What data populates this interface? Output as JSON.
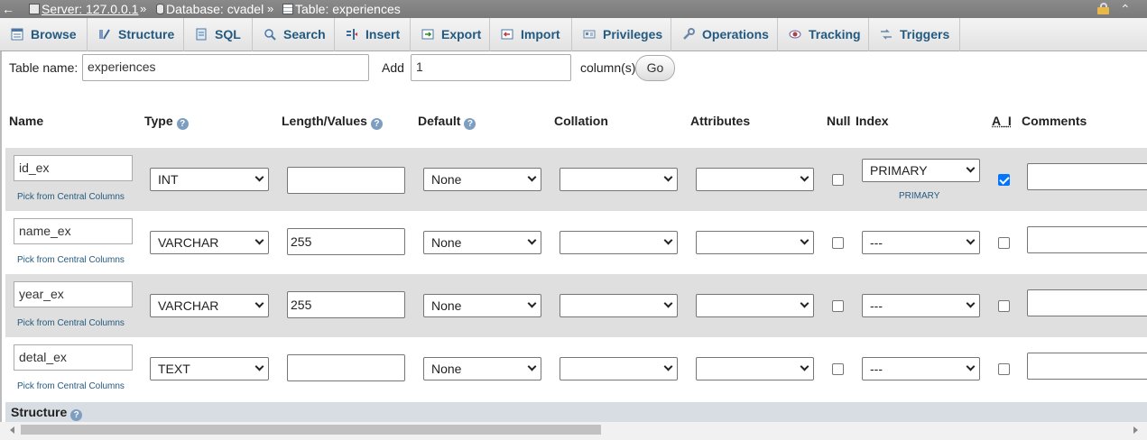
{
  "breadcrumb": {
    "back": "←",
    "server": "Server: 127.0.0.1",
    "database": "Database: cvadel",
    "table": "Table: experiences",
    "separator": "»"
  },
  "tabs": [
    {
      "label": "Browse",
      "icon": "browse-icon"
    },
    {
      "label": "Structure",
      "icon": "structure-icon"
    },
    {
      "label": "SQL",
      "icon": "sql-icon"
    },
    {
      "label": "Search",
      "icon": "search-icon"
    },
    {
      "label": "Insert",
      "icon": "insert-icon"
    },
    {
      "label": "Export",
      "icon": "export-icon"
    },
    {
      "label": "Import",
      "icon": "import-icon"
    },
    {
      "label": "Privileges",
      "icon": "privileges-icon"
    },
    {
      "label": "Operations",
      "icon": "operations-icon"
    },
    {
      "label": "Tracking",
      "icon": "tracking-icon"
    },
    {
      "label": "Triggers",
      "icon": "triggers-icon"
    }
  ],
  "form": {
    "table_name_label": "Table name:",
    "table_name_value": "experiences",
    "add_label": "Add",
    "add_value": "1",
    "columns_label": "column(s)",
    "go_label": "Go"
  },
  "headers": {
    "name": "Name",
    "type": "Type",
    "length": "Length/Values",
    "default": "Default",
    "collation": "Collation",
    "attributes": "Attributes",
    "null": "Null",
    "index": "Index",
    "ai": "A_I",
    "comments": "Comments",
    "help": "?"
  },
  "pick_label": "Pick from Central Columns",
  "rows": [
    {
      "name": "id_ex",
      "type": "INT",
      "length": "",
      "default": "None",
      "collation": "",
      "attributes": "",
      "null": false,
      "index": "PRIMARY",
      "index_note": "PRIMARY",
      "ai": true,
      "comments": ""
    },
    {
      "name": "name_ex",
      "type": "VARCHAR",
      "length": "255",
      "default": "None",
      "collation": "",
      "attributes": "",
      "null": false,
      "index": "---",
      "index_note": "",
      "ai": false,
      "comments": ""
    },
    {
      "name": "year_ex",
      "type": "VARCHAR",
      "length": "255",
      "default": "None",
      "collation": "",
      "attributes": "",
      "null": false,
      "index": "---",
      "index_note": "",
      "ai": false,
      "comments": ""
    },
    {
      "name": "detal_ex",
      "type": "TEXT",
      "length": "",
      "default": "None",
      "collation": "",
      "attributes": "",
      "null": false,
      "index": "---",
      "index_note": "",
      "ai": false,
      "comments": ""
    }
  ],
  "structure_label": "Structure",
  "colors": {
    "accent": "#235a81",
    "row_odd": "#dfdfdf",
    "checkbox_on": "#0075ff"
  }
}
